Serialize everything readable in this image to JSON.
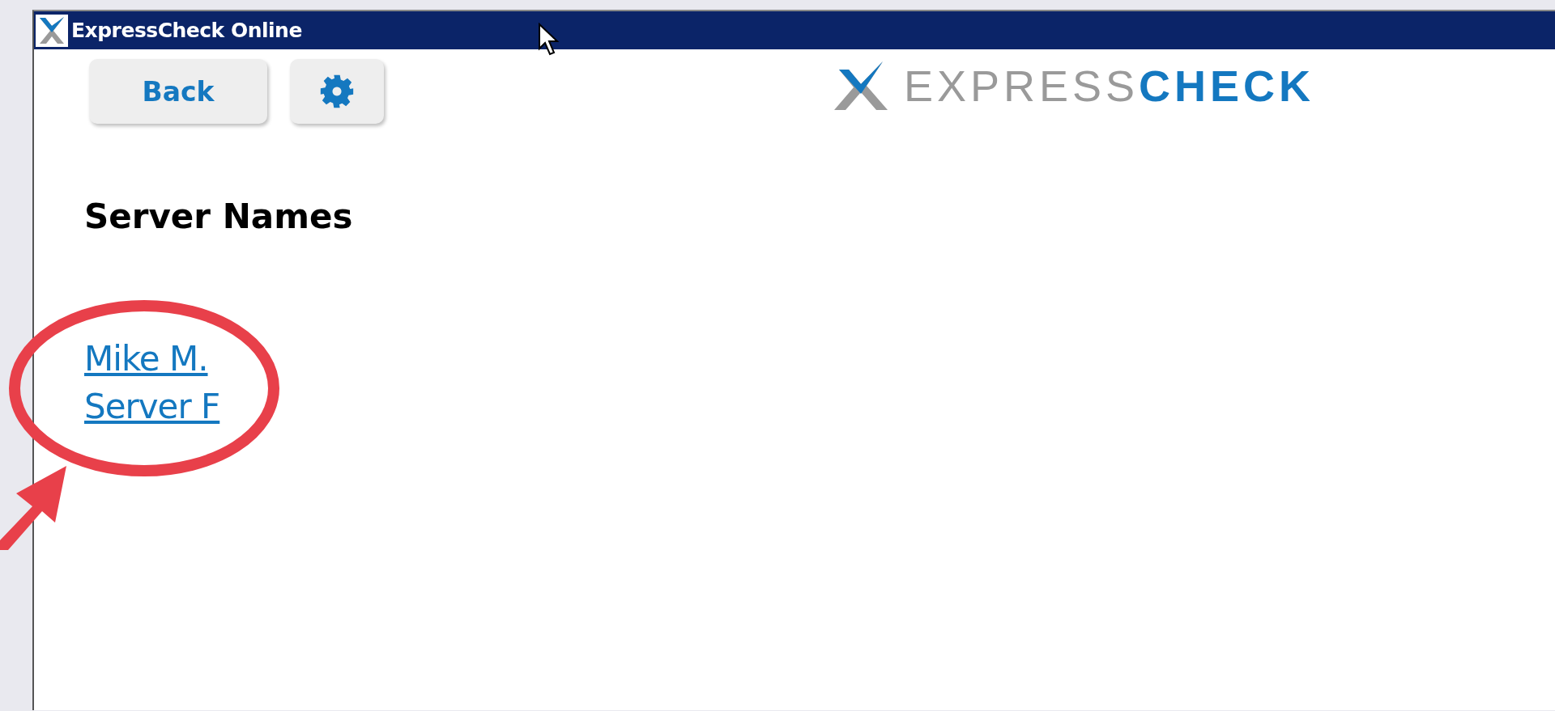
{
  "window": {
    "title": "ExpressCheck Online"
  },
  "toolbar": {
    "back_button": "Back"
  },
  "logo": {
    "text": "EXPRESS**CHECK**"
  },
  "heading": "Server Names",
  "servers": [
    {
      "name": "Mike M."
    },
    {
      "name": "Server F"
    }
  ]
}
